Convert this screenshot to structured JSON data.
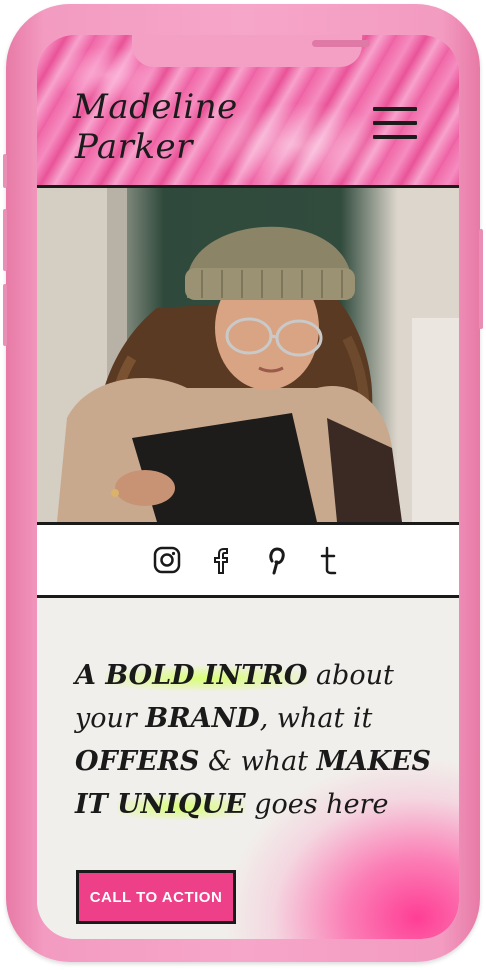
{
  "brand": {
    "line1": "Madeline",
    "line2": "Parker"
  },
  "menu": {
    "icon": "hamburger-menu-icon"
  },
  "social": {
    "icons": [
      "instagram-icon",
      "facebook-icon",
      "pinterest-icon",
      "tumblr-icon"
    ]
  },
  "intro": {
    "p1": "A ",
    "p2": "BOLD INTRO",
    "p3": " about",
    "p4": "your ",
    "p5": "BRAND",
    "p6": ", what it",
    "p7": "OFFERS",
    "p8": " & what ",
    "p9": "MAKES",
    "p10": "IT ",
    "p11": "UNIQUE",
    "p12": " goes here"
  },
  "cta": {
    "label": "CALL TO ACTION"
  },
  "colors": {
    "accent_pink": "#ee3f89",
    "header_pink": "#f06aa8",
    "highlight_green": "#d7ff6e",
    "ink": "#1a1a1a",
    "phone_frame": "#f6a6c9"
  }
}
